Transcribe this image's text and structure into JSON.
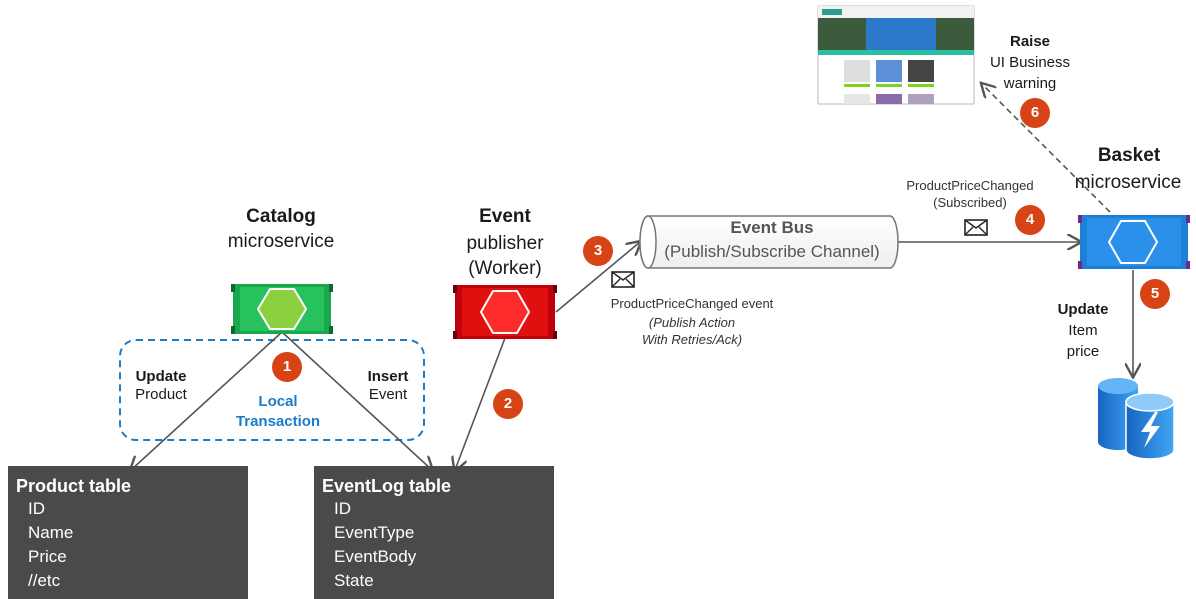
{
  "catalog": {
    "title": "Catalog",
    "subtitle": "microservice",
    "color": "#1aa84c"
  },
  "publisher": {
    "title": "Event",
    "line2": "publisher",
    "line3": "(Worker)",
    "color": "#c0000a"
  },
  "basket": {
    "title": "Basket",
    "subtitle": "microservice",
    "color": "#1e7fd6"
  },
  "event_bus": {
    "title": "Event Bus",
    "subtitle": "(Publish/Subscribe Channel)"
  },
  "transaction": {
    "line1": "Local",
    "line2": "Transaction"
  },
  "labels": {
    "update_bold": "Update",
    "update_text": "Product",
    "insert_bold": "Insert",
    "insert_text": "Event",
    "ppc_event": "ProductPriceChanged event",
    "publish_action": "(Publish Action",
    "with_retries": "With Retries/Ack)",
    "ppc_sub1": "ProductPriceChanged",
    "ppc_sub2": "(Subscribed)",
    "raise_bold": "Raise",
    "raise_l2": "UI Business",
    "raise_l3": "warning",
    "update_item_bold": "Update",
    "update_item_l2": "Item",
    "update_item_l3": "price"
  },
  "badges": [
    "1",
    "2",
    "3",
    "4",
    "5",
    "6"
  ],
  "product_table": {
    "title": "Product table",
    "fields": [
      "ID",
      "Name",
      "Price",
      "//etc"
    ]
  },
  "eventlog_table": {
    "title": "EventLog table",
    "fields": [
      "ID",
      "EventType",
      "EventBody",
      "State"
    ]
  },
  "icons": [
    "hexagon-service-icon",
    "envelope-icon",
    "database-icon",
    "lightning-icon",
    "webpage-screenshot-icon"
  ]
}
